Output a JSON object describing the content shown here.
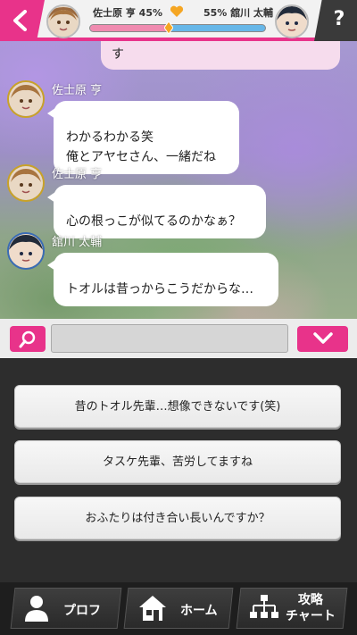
{
  "header": {
    "left_character": {
      "name": "佐士原 亨",
      "affinity_text": "佐士原 亨 45%",
      "affinity": 45
    },
    "right_character": {
      "name": "舘川 太輔",
      "affinity_text": "55% 舘川 太輔",
      "affinity": 55
    },
    "help_label": "?",
    "icons": {
      "back": "chevron-left-icon",
      "heart": "heart-icon",
      "help": "question-icon"
    },
    "colors": {
      "accent": "#e8338a",
      "left_bar": "#f08bb0",
      "right_bar": "#67b7e8",
      "heart": "#f5a623"
    }
  },
  "chat": {
    "previous_fragment": "す",
    "messages": [
      {
        "sender": "佐士原 亨",
        "text": "わかるわかる笑\n俺とアヤセさん、一緒だね"
      },
      {
        "sender": "佐士原 亨",
        "text": "心の根っこが似てるのかなぁ？"
      },
      {
        "sender": "舘川 太輔",
        "text": "トオルは昔っからこうだからな…"
      }
    ]
  },
  "search": {
    "value": "",
    "placeholder": "",
    "icons": {
      "search": "magnifier-icon",
      "collapse": "chevron-down-icon"
    }
  },
  "choices": [
    "昔のトオル先輩…想像できないです(笑)",
    "タスケ先輩、苦労してますね",
    "おふたりは付き合い長いんですか？"
  ],
  "bottom_nav": {
    "profile": {
      "label": "プロフ",
      "icon": "person-icon"
    },
    "home": {
      "label": "ホーム",
      "icon": "house-icon"
    },
    "chart": {
      "label": "攻略\nチャート",
      "icon": "flowchart-icon"
    }
  }
}
